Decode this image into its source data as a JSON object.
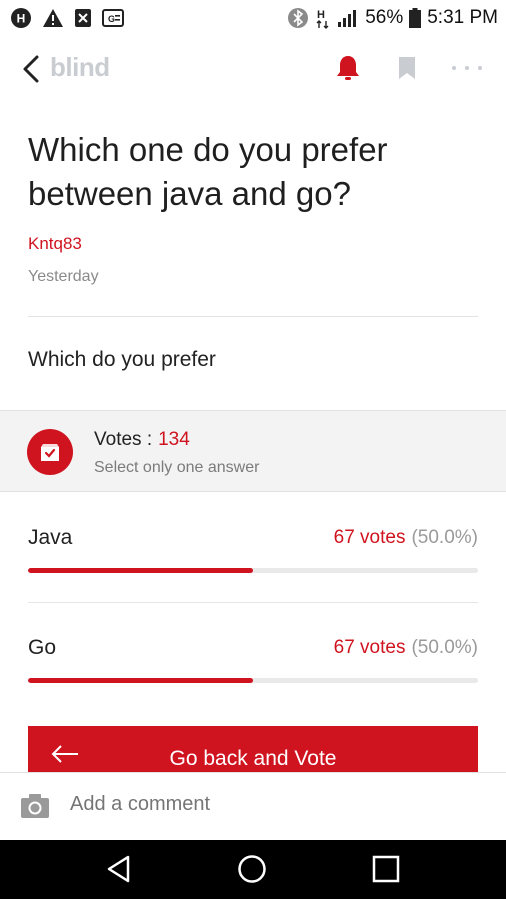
{
  "status_bar": {
    "battery": "56%",
    "time": "5:31 PM",
    "icons": [
      "hangouts-icon",
      "warning-icon",
      "x-app-icon",
      "gboard-icon",
      "bluetooth-icon",
      "h-plus-icon",
      "signal-icon",
      "battery-icon"
    ]
  },
  "header": {
    "logo": "blind",
    "icons": [
      "back-chevron-icon",
      "bell-icon",
      "bookmark-icon",
      "more-dots-icon"
    ],
    "bell_active": true
  },
  "post": {
    "title": "Which one do you prefer between java and go?",
    "author": "Kntq83",
    "date": "Yesterday",
    "body": "Which do you prefer"
  },
  "poll": {
    "votes_label": "Votes :",
    "votes_count": "134",
    "hint": "Select only one answer",
    "options": [
      {
        "label": "Java",
        "votes": "67 votes",
        "pct": "(50.0%)",
        "fraction": 0.5
      },
      {
        "label": "Go",
        "votes": "67 votes",
        "pct": "(50.0%)",
        "fraction": 0.5
      }
    ]
  },
  "vote_button": {
    "label": "Go back and Vote"
  },
  "comment": {
    "placeholder": "Add a comment"
  },
  "colors": {
    "accent": "#d0141f",
    "muted": "#8a8a8a"
  }
}
